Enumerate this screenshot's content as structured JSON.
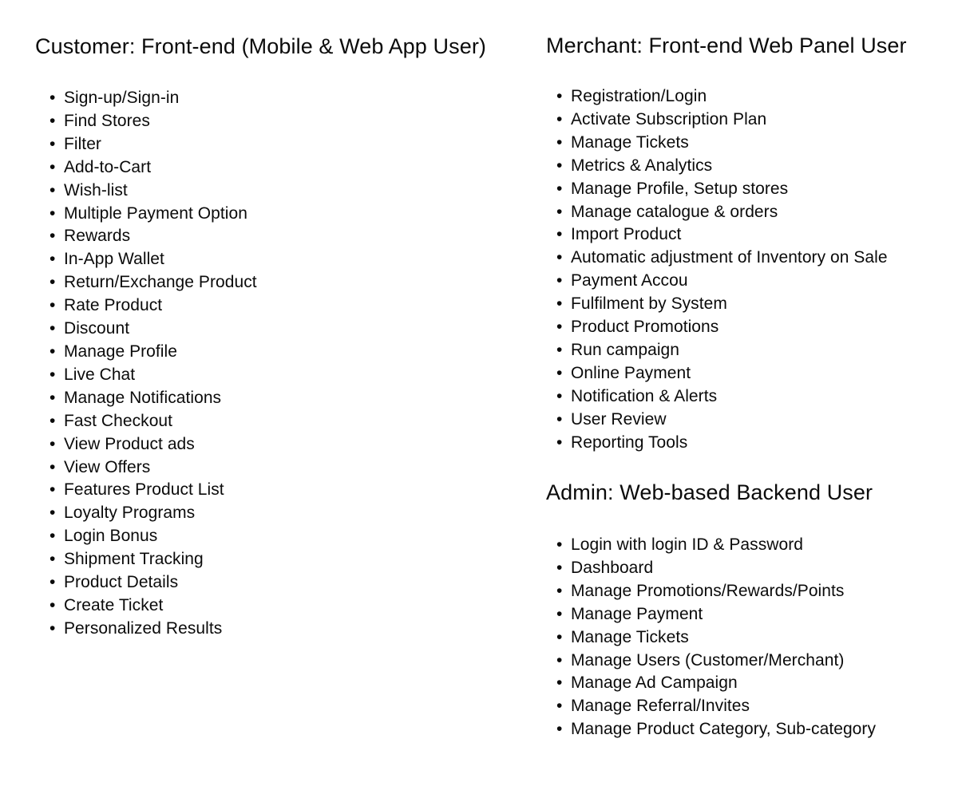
{
  "document": {
    "background_color": "#ffffff",
    "text_color": "#0b0b0b",
    "bullet_glyph": "•"
  },
  "columns": {
    "left": {
      "section": {
        "heading": "Customer: Front-end (Mobile & Web App User)",
        "items": [
          "Sign-up/Sign-in",
          "Find Stores",
          "Filter",
          "Add-to-Cart",
          "Wish-list",
          "Multiple Payment Option",
          "Rewards",
          "In-App Wallet",
          "Return/Exchange Product",
          "Rate Product",
          "Discount",
          "Manage Profile",
          "Live Chat",
          "Manage Notifications",
          "Fast Checkout",
          "View Product ads",
          "View Offers",
          "Features Product List",
          "Loyalty Programs",
          "Login Bonus",
          "Shipment Tracking",
          "Product Details",
          "Create Ticket",
          "Personalized Results"
        ]
      }
    },
    "right": {
      "sections": [
        {
          "heading": "Merchant: Front-end Web Panel User",
          "items": [
            "Registration/Login",
            "Activate Subscription Plan",
            "Manage Tickets",
            "Metrics & Analytics",
            "Manage Profile, Setup stores",
            "Manage catalogue & orders",
            "Import Product",
            "Automatic adjustment of Inventory on Sale",
            "Payment Accou",
            "Fulfilment by System",
            "Product Promotions",
            "Run campaign",
            "Online Payment",
            "Notification & Alerts",
            "User Review",
            "Reporting Tools"
          ]
        },
        {
          "heading": "Admin: Web-based Backend User",
          "items": [
            "Login with login ID & Password",
            "Dashboard",
            "Manage Promotions/Rewards/Points",
            "Manage Payment",
            "Manage Tickets",
            "Manage Users (Customer/Merchant)",
            "Manage Ad Campaign",
            "Manage Referral/Invites",
            "Manage Product Category, Sub-category"
          ]
        }
      ]
    }
  }
}
